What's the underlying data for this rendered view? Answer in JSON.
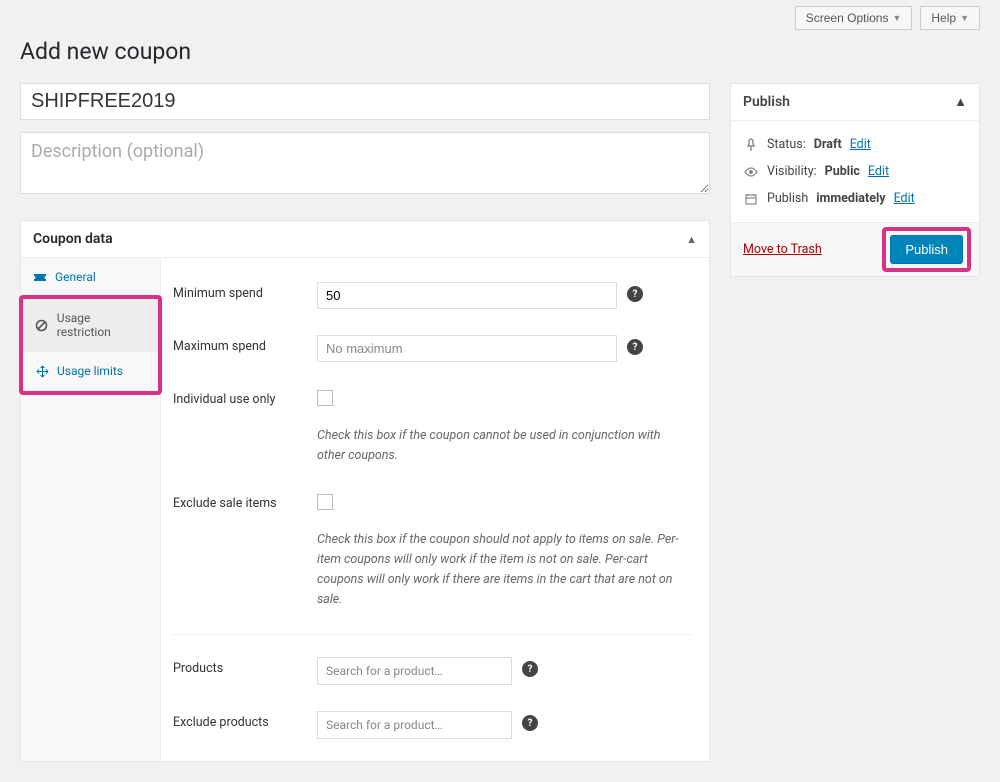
{
  "topbar": {
    "screen_options": "Screen Options",
    "help": "Help"
  },
  "page_title": "Add new coupon",
  "coupon_code": "SHIPFREE2019",
  "description_placeholder": "Description (optional)",
  "coupon_data": {
    "panel_title": "Coupon data",
    "tabs": {
      "general": "General",
      "usage_restriction": "Usage restriction",
      "usage_limits": "Usage limits"
    },
    "fields": {
      "min_spend": {
        "label": "Minimum spend",
        "value": "50"
      },
      "max_spend": {
        "label": "Maximum spend",
        "placeholder": "No maximum"
      },
      "individual_use": {
        "label": "Individual use only",
        "desc": "Check this box if the coupon cannot be used in conjunction with other coupons."
      },
      "exclude_sale": {
        "label": "Exclude sale items",
        "desc": "Check this box if the coupon should not apply to items on sale. Per-item coupons will only work if the item is not on sale. Per-cart coupons will only work if there are items in the cart that are not on sale."
      },
      "products": {
        "label": "Products",
        "placeholder": "Search for a product…"
      },
      "exclude_products": {
        "label": "Exclude products",
        "placeholder": "Search for a product…"
      }
    }
  },
  "publish": {
    "title": "Publish",
    "status_label": "Status:",
    "status_value": "Draft",
    "visibility_label": "Visibility:",
    "visibility_value": "Public",
    "publish_label": "Publish",
    "publish_value": "immediately",
    "edit": "Edit",
    "move_to_trash": "Move to Trash",
    "button": "Publish"
  }
}
